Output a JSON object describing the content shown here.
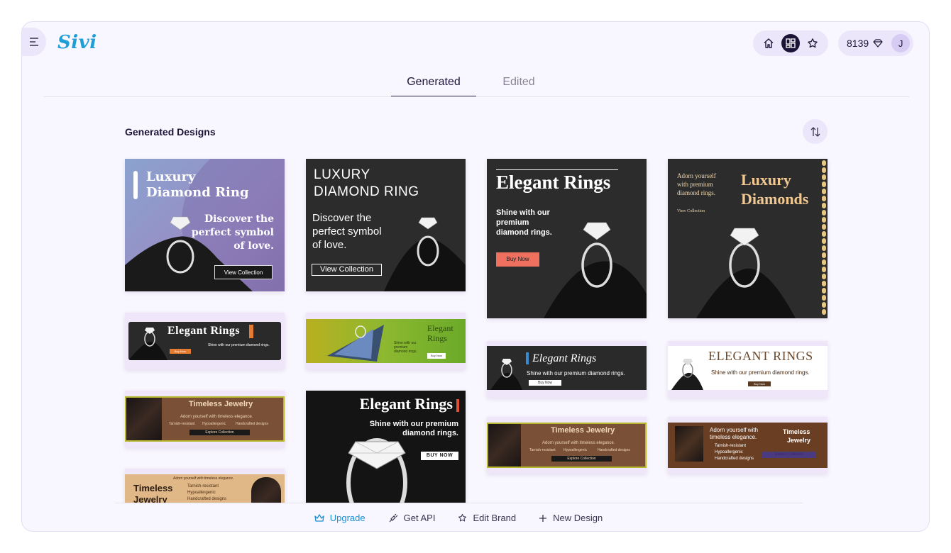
{
  "app": {
    "logo": "Sivi"
  },
  "header": {
    "credits": "8139",
    "avatar_initial": "J"
  },
  "tabs": [
    {
      "label": "Generated"
    },
    {
      "label": "Edited"
    }
  ],
  "section": {
    "title": "Generated Designs"
  },
  "cards": {
    "c1": {
      "line1": "Luxury",
      "line2": "Diamond Ring",
      "body1": "Discover the",
      "body2": "perfect symbol",
      "body3": "of love.",
      "cta": "View Collection"
    },
    "c2": {
      "line1": "LUXURY",
      "line2": "DIAMOND RING",
      "body1": "Discover the",
      "body2": "perfect symbol",
      "body3": "of love.",
      "cta": "View Collection"
    },
    "c3": {
      "title": "Elegant Rings",
      "body1": "Shine with our",
      "body2": "premium",
      "body3": "diamond rings.",
      "cta": "Buy Now"
    },
    "c4": {
      "small1": "Adorn yourself",
      "small2": "with premium",
      "small3": "diamond rings.",
      "link": "View Collection",
      "title1": "Luxury",
      "title2": "Diamonds"
    },
    "c5": {
      "title": "Elegant Rings",
      "sub": "Shine with our premium diamond rings.",
      "cta": "Buy Now"
    },
    "c6": {
      "title1": "Elegant",
      "title2": "Rings",
      "sub1": "Shine with our",
      "sub2": "premium",
      "sub3": "diamond rings.",
      "cta": "Buy Now"
    },
    "c7": {
      "title": "Elegant Rings",
      "sub": "Shine with our premium diamond rings.",
      "cta": "Buy Now"
    },
    "c8": {
      "title": "ELEGANT RINGS",
      "sub": "Shine with our premium diamond rings.",
      "cta": "Buy Now"
    },
    "c9": {
      "title": "Timeless Jewelry",
      "sub": "Adorn yourself with timeless elegance.",
      "b1": "Tarnish-resistant",
      "b2": "Hypoallergenic",
      "b3": "Handcrafted designs",
      "cta": "Explore Collection"
    },
    "c10": {
      "title": "Elegant Rings",
      "sub1": "Shine with our premium",
      "sub2": "diamond rings.",
      "cta": "BUY NOW"
    },
    "c11": {
      "title": "Timeless Jewelry",
      "sub": "Adorn yourself with timeless elegance.",
      "b1": "Tarnish-resistant",
      "b2": "Hypoallergenic",
      "b3": "Handcrafted designs",
      "cta": "Explore Collection"
    },
    "c12": {
      "sub1": "Adorn yourself with",
      "sub2": "timeless elegance.",
      "b1": "Tarnish-resistant",
      "b2": "Hypoallergenic",
      "b3": "Handcrafted designs",
      "title1": "Timeless",
      "title2": "Jewelry",
      "cta": "Explore Collection"
    },
    "c13": {
      "title1": "Timeless",
      "title2": "Jewelry",
      "sub": "Adorn yourself with timeless elegance.",
      "b1": "Tarnish-resistant",
      "b2": "Hypoallergenic",
      "b3": "Handcrafted designs"
    }
  },
  "bottom_bar": {
    "upgrade": "Upgrade",
    "get_api": "Get API",
    "edit_brand": "Edit Brand",
    "new_design": "New Design"
  },
  "colors": {
    "accent": "#1f9fd6",
    "surface": "#f8f6fe",
    "chip": "#ece6fb",
    "dark": "#1c1436"
  }
}
